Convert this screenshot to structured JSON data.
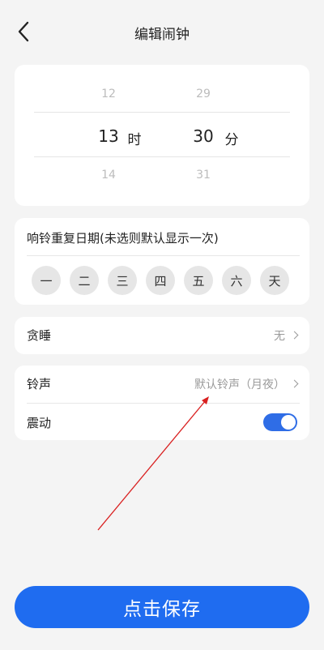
{
  "header": {
    "title": "编辑闹钟"
  },
  "picker": {
    "hour_prev": "12",
    "hour_current": "13",
    "hour_next": "14",
    "hour_unit": "时",
    "minute_prev": "29",
    "minute_current": "30",
    "minute_next": "31",
    "minute_unit": "分"
  },
  "repeat": {
    "label": "响铃重复日期(未选则默认显示一次)",
    "days": [
      "一",
      "二",
      "三",
      "四",
      "五",
      "六",
      "天"
    ]
  },
  "snooze": {
    "label": "贪睡",
    "value": "无"
  },
  "ringtone": {
    "label": "铃声",
    "value": "默认铃声（月夜）"
  },
  "vibrate": {
    "label": "震动",
    "on": true
  },
  "save_label": "点击保存",
  "colors": {
    "accent": "#1f6cf0",
    "annotation_arrow": "#d92020"
  }
}
